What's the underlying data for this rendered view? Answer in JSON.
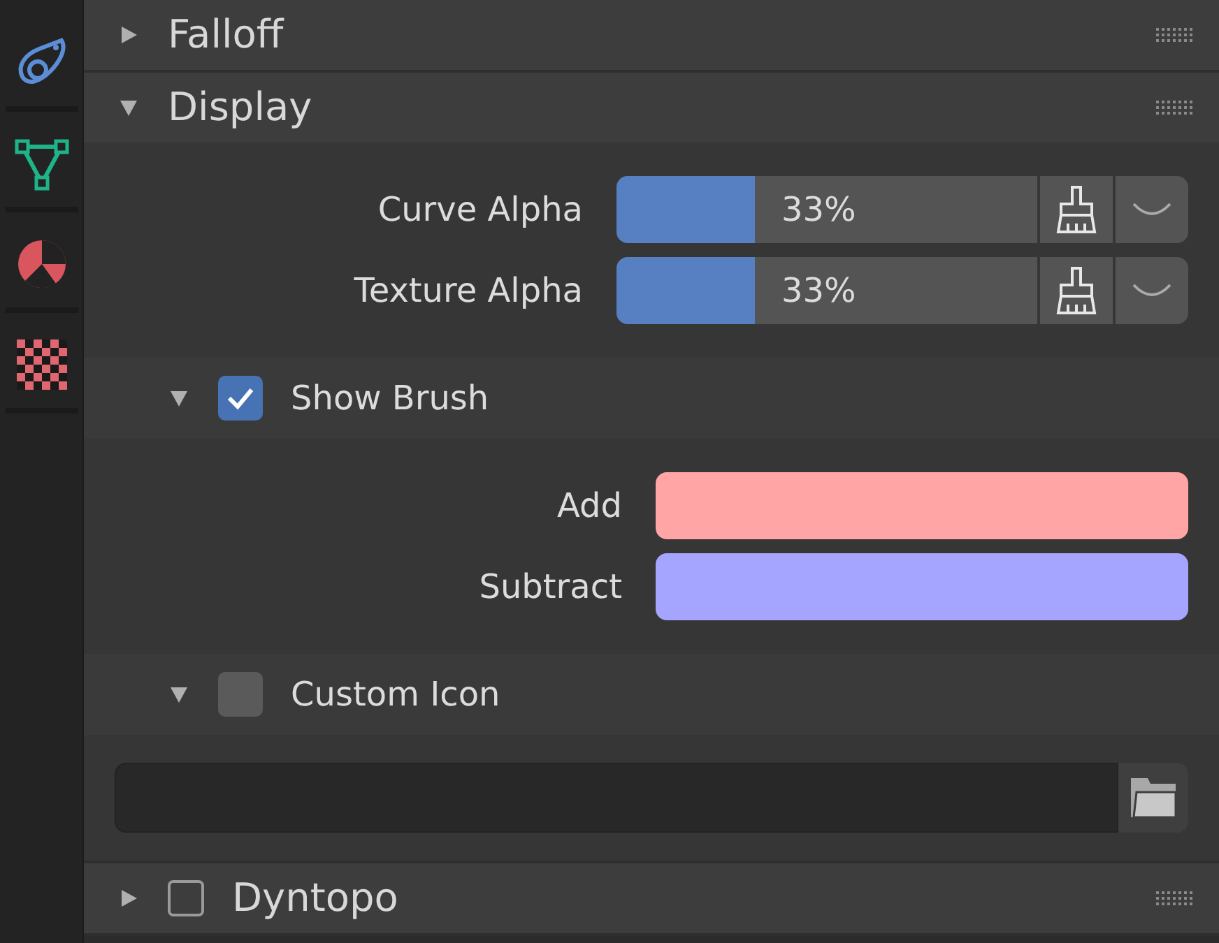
{
  "sidebar": {
    "tabs": [
      {
        "kind": "brush",
        "selected": false
      },
      {
        "kind": "mesh",
        "selected": false
      },
      {
        "kind": "material",
        "selected": false
      },
      {
        "kind": "texture",
        "selected": false
      }
    ]
  },
  "panels": [
    {
      "title": "Falloff",
      "expanded": false
    },
    {
      "title": "Display",
      "expanded": true,
      "sliders": [
        {
          "label": "Curve Alpha",
          "level": 0.33,
          "reading": "33%"
        },
        {
          "label": "Texture Alpha",
          "level": 0.33,
          "reading": "33%"
        }
      ],
      "subpanels": [
        {
          "kind": "colors",
          "title": "Show Brush",
          "checked": true,
          "expanded": true,
          "colors": [
            {
              "label": "Add",
              "color": "#ffa5a5"
            },
            {
              "label": "Subtract",
              "color": "#a5a5ff"
            }
          ]
        },
        {
          "kind": "file",
          "title": "Custom Icon",
          "checked": false,
          "expanded": true
        }
      ]
    },
    {
      "title": "Dyntopo",
      "expanded": false,
      "checked": false
    }
  ]
}
